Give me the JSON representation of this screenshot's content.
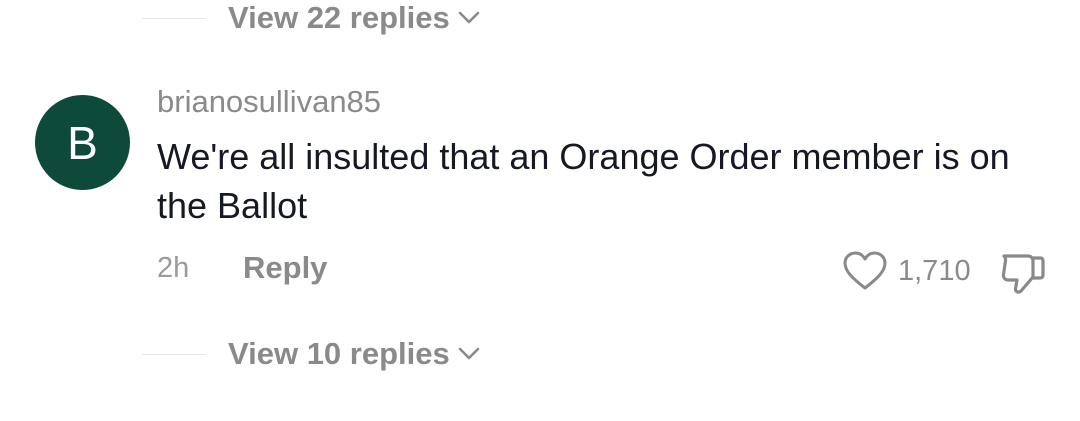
{
  "thread_top": {
    "view_replies_label": "View 22 replies",
    "chevron_icon": "chevron-down-icon"
  },
  "comment": {
    "avatar_letter": "B",
    "avatar_color": "#0d4a3a",
    "username": "brianosullivan85",
    "text": "We're all insulted that an Orange Order member is on the Ballot",
    "timestamp": "2h",
    "reply_label": "Reply",
    "like_icon": "heart-outline-icon",
    "like_count": "1,710",
    "dislike_icon": "thumbs-down-icon"
  },
  "thread_bottom": {
    "view_replies_label": "View 10 replies",
    "chevron_icon": "chevron-down-icon"
  }
}
